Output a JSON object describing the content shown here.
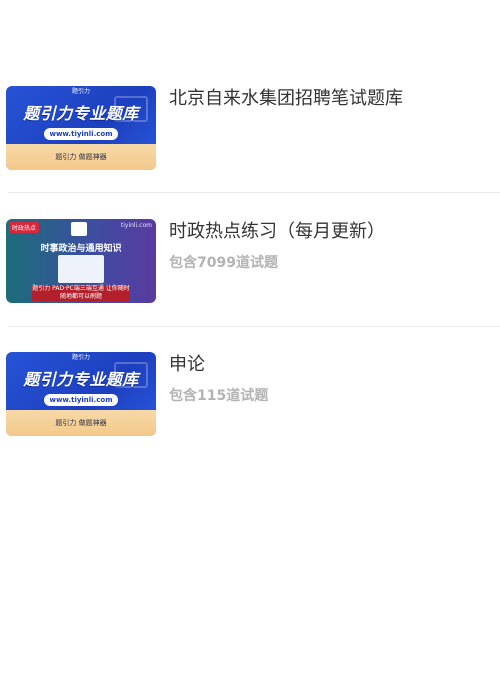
{
  "items": [
    {
      "title": "北京自来水集团招聘笔试题库",
      "subtitle": "",
      "thumb": {
        "style": "brand",
        "logo": "题引力",
        "headline": "题引力专业题库",
        "url": "www.tiyinli.com",
        "tagline": "题引力 做题神器"
      }
    },
    {
      "title": "时政热点练习（每月更新）",
      "subtitle": "包含7099道试题",
      "thumb": {
        "style": "news",
        "badge": "时政热点",
        "site": "tiyinli.com",
        "headline": "时事政治与通用知识",
        "banner": "题引力 PAD·PC端三端互通 让你随时随地都可以刷题"
      }
    },
    {
      "title": "申论",
      "subtitle": "包含115道试题",
      "thumb": {
        "style": "brand",
        "logo": "题引力",
        "headline": "题引力专业题库",
        "url": "www.tiyinli.com",
        "tagline": "题引力 做题神器"
      }
    }
  ],
  "colors": {
    "title": "#333333",
    "subtitle": "#b3b3b3",
    "divider": "#ececec",
    "brand_blue": "#1c3fbe",
    "brand_band": "#f3c98a"
  }
}
